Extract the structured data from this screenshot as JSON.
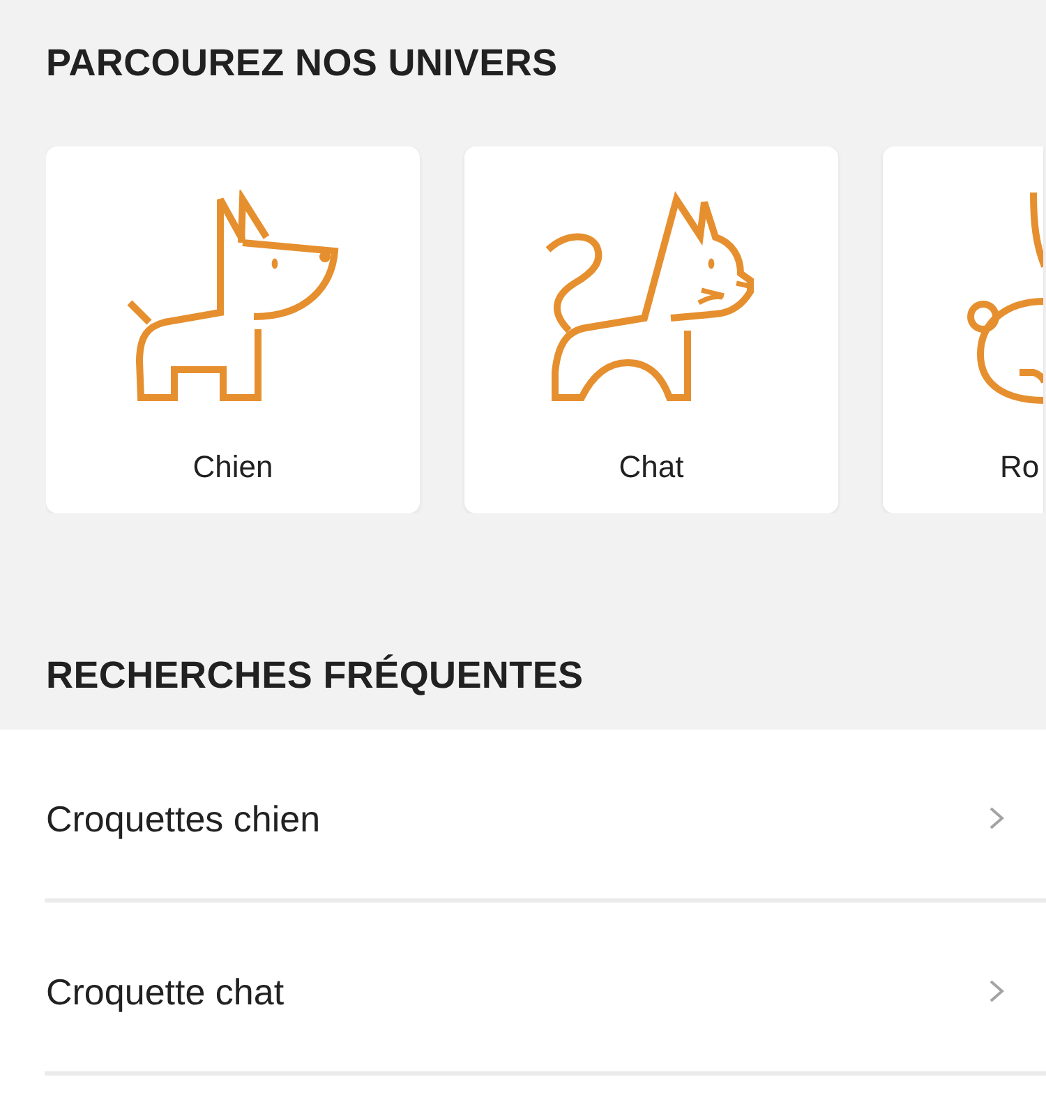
{
  "universes": {
    "title": "PARCOUREZ NOS UNIVERS",
    "cards": [
      {
        "label": "Chien"
      },
      {
        "label": "Chat"
      },
      {
        "label": "Ro"
      }
    ]
  },
  "frequent_searches": {
    "title": "RECHERCHES FRÉQUENTES",
    "items": [
      {
        "label": "Croquettes chien"
      },
      {
        "label": "Croquette chat"
      }
    ]
  }
}
